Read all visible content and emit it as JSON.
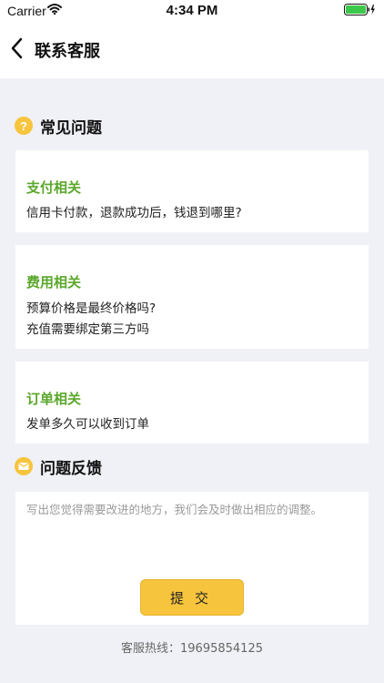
{
  "status_bar": {
    "carrier": "Carrier",
    "time": "4:34 PM",
    "wifi_icon": "wifi-icon",
    "battery_icon": "battery-icon",
    "battery_color": "#3cc84a"
  },
  "nav": {
    "title": "联系客服",
    "back_icon": "chevron-left-icon"
  },
  "faq": {
    "title": "常见问题",
    "icon": "question-circle-icon",
    "icon_glyph": "?",
    "categories": [
      {
        "name": "支付相关",
        "questions": [
          "信用卡付款，退款成功后，钱退到哪里?"
        ]
      },
      {
        "name": "费用相关",
        "questions": [
          "预算价格是最终价格吗?",
          "充值需要绑定第三方吗"
        ]
      },
      {
        "name": "订单相关",
        "questions": [
          "发单多久可以收到订单"
        ]
      }
    ]
  },
  "feedback": {
    "title": "问题反馈",
    "icon": "envelope-icon",
    "placeholder": "写出您觉得需要改进的地方，我们会及时做出相应的调整。",
    "value": "",
    "submit_label": "提交"
  },
  "hotline": "客服热线：19695854125",
  "colors": {
    "accent": "#f7c43d",
    "category_green": "#5aa72a",
    "page_bg": "#f0f1f6"
  }
}
